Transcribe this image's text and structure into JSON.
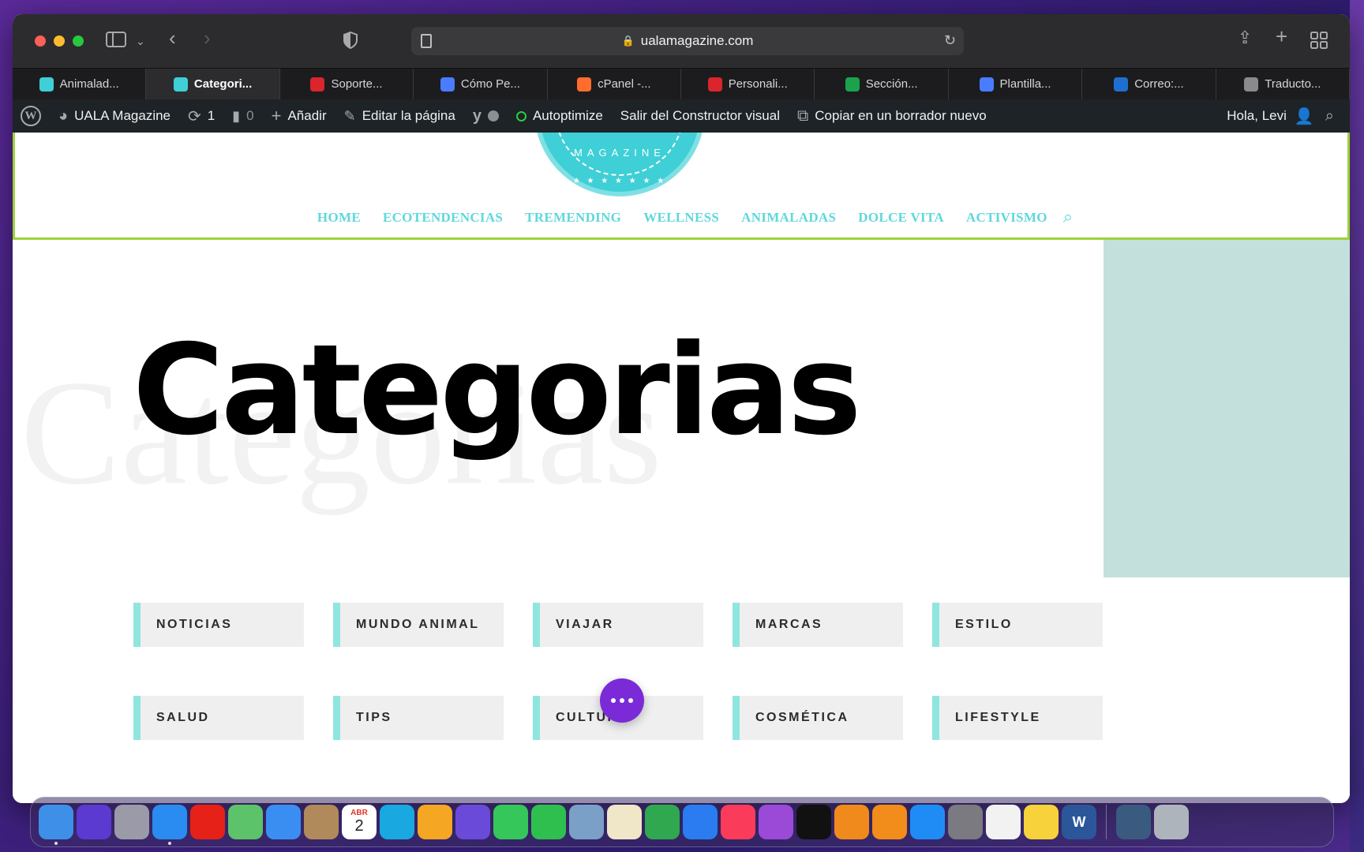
{
  "browser": {
    "url": "ualamagazine.com",
    "tabs": [
      {
        "label": "Animalad...",
        "icon": "uala-favicon",
        "color": "#3fcfd6"
      },
      {
        "label": "Categori...",
        "icon": "uala-favicon",
        "color": "#3fcfd6",
        "active": true
      },
      {
        "label": "Soporte...",
        "icon": "webempresa-favicon",
        "color": "#d9252b"
      },
      {
        "label": "Cómo Pe...",
        "icon": "appsheet-favicon",
        "color": "#4a7cff"
      },
      {
        "label": "cPanel -...",
        "icon": "cpanel-favicon",
        "color": "#ff6c2c"
      },
      {
        "label": "Personali...",
        "icon": "webempresa-favicon",
        "color": "#d9252b"
      },
      {
        "label": "Sección...",
        "icon": "w-green-favicon",
        "color": "#1aa34a"
      },
      {
        "label": "Plantilla...",
        "icon": "appsheet-favicon",
        "color": "#4a7cff"
      },
      {
        "label": "Correo:...",
        "icon": "outlook-favicon",
        "color": "#1f6fd1"
      },
      {
        "label": "Traducto...",
        "icon": "google-favicon",
        "color": "#8a8a8a"
      }
    ]
  },
  "adminbar": {
    "site_name": "UALA Magazine",
    "updates_count": "1",
    "comments_count": "0",
    "add_new": "Añadir",
    "edit_page": "Editar la página",
    "autoptimize": "Autoptimize",
    "exit_builder": "Salir del Constructor visual",
    "copy_draft": "Copiar en un borrador nuevo",
    "greeting": "Hola, Levi"
  },
  "site": {
    "logo_text": "MAGAZINE",
    "nav": [
      "HOME",
      "ECOTENDENCIAS",
      "TREMENDING",
      "WELLNESS",
      "ANIMALADAS",
      "DOLCE VITA",
      "ACTIVISMO"
    ],
    "accent_color": "#5ed8dc"
  },
  "page": {
    "title": "Categorias",
    "ghost_title": "Categorias",
    "categories": [
      "NOTICIAS",
      "MUNDO ANIMAL",
      "VIAJAR",
      "MARCAS",
      "ESTILO",
      "SALUD",
      "TIPS",
      "CULTURA",
      "COSMÉTICA",
      "LIFESTYLE"
    ]
  },
  "dock": {
    "calendar_month": "ABR",
    "calendar_day": "2",
    "apps": [
      "finder",
      "siri",
      "launchpad",
      "safari",
      "youtube",
      "maps",
      "mail",
      "contacts",
      "calendar",
      "canva",
      "photos",
      "imovie",
      "messages",
      "facetime",
      "preview",
      "textedit",
      "numbers",
      "keynote",
      "music",
      "podcasts",
      "apple-tv",
      "pages",
      "books",
      "app-store",
      "system-preferences",
      "reminders",
      "notes",
      "word",
      "quicktime",
      "trash"
    ]
  }
}
